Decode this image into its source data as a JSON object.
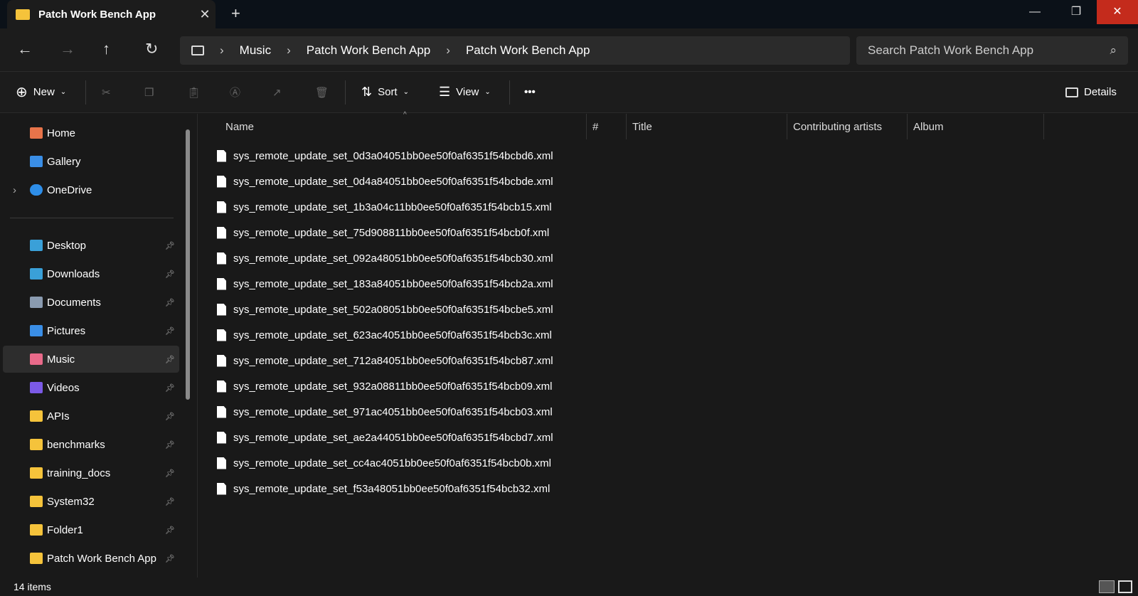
{
  "window": {
    "tab_title": "Patch Work Bench App",
    "new_tab": "+",
    "close_tab": "✕",
    "minimize": "—",
    "restore": "❐",
    "close": "✕"
  },
  "nav": {
    "back": "←",
    "forward": "→",
    "up": "↑",
    "refresh": "↻"
  },
  "breadcrumb": [
    "Music",
    "Patch Work Bench App",
    "Patch Work Bench App"
  ],
  "search": {
    "placeholder": "Search Patch Work Bench App"
  },
  "toolbar": {
    "new": "New",
    "sort": "Sort",
    "view": "View",
    "more": "•••",
    "details": "Details"
  },
  "sidebar": {
    "top": [
      {
        "label": "Home"
      },
      {
        "label": "Gallery"
      },
      {
        "label": "OneDrive"
      }
    ],
    "pinned": [
      {
        "label": "Desktop"
      },
      {
        "label": "Downloads"
      },
      {
        "label": "Documents"
      },
      {
        "label": "Pictures"
      },
      {
        "label": "Music"
      },
      {
        "label": "Videos"
      },
      {
        "label": "APIs"
      },
      {
        "label": "benchmarks"
      },
      {
        "label": "training_docs"
      },
      {
        "label": "System32"
      },
      {
        "label": "Folder1"
      },
      {
        "label": "Patch Work Bench App"
      }
    ]
  },
  "columns": [
    "Name",
    "#",
    "Title",
    "Contributing artists",
    "Album"
  ],
  "files": [
    "sys_remote_update_set_0d3a04051bb0ee50f0af6351f54bcbd6.xml",
    "sys_remote_update_set_0d4a84051bb0ee50f0af6351f54bcbde.xml",
    "sys_remote_update_set_1b3a04c11bb0ee50f0af6351f54bcb15.xml",
    "sys_remote_update_set_75d908811bb0ee50f0af6351f54bcb0f.xml",
    "sys_remote_update_set_092a48051bb0ee50f0af6351f54bcb30.xml",
    "sys_remote_update_set_183a84051bb0ee50f0af6351f54bcb2a.xml",
    "sys_remote_update_set_502a08051bb0ee50f0af6351f54bcbe5.xml",
    "sys_remote_update_set_623ac4051bb0ee50f0af6351f54bcb3c.xml",
    "sys_remote_update_set_712a84051bb0ee50f0af6351f54bcb87.xml",
    "sys_remote_update_set_932a08811bb0ee50f0af6351f54bcb09.xml",
    "sys_remote_update_set_971ac4051bb0ee50f0af6351f54bcb03.xml",
    "sys_remote_update_set_ae2a44051bb0ee50f0af6351f54bcbd7.xml",
    "sys_remote_update_set_cc4ac4051bb0ee50f0af6351f54bcb0b.xml",
    "sys_remote_update_set_f53a48051bb0ee50f0af6351f54bcb32.xml"
  ],
  "status": {
    "count": "14 items"
  }
}
